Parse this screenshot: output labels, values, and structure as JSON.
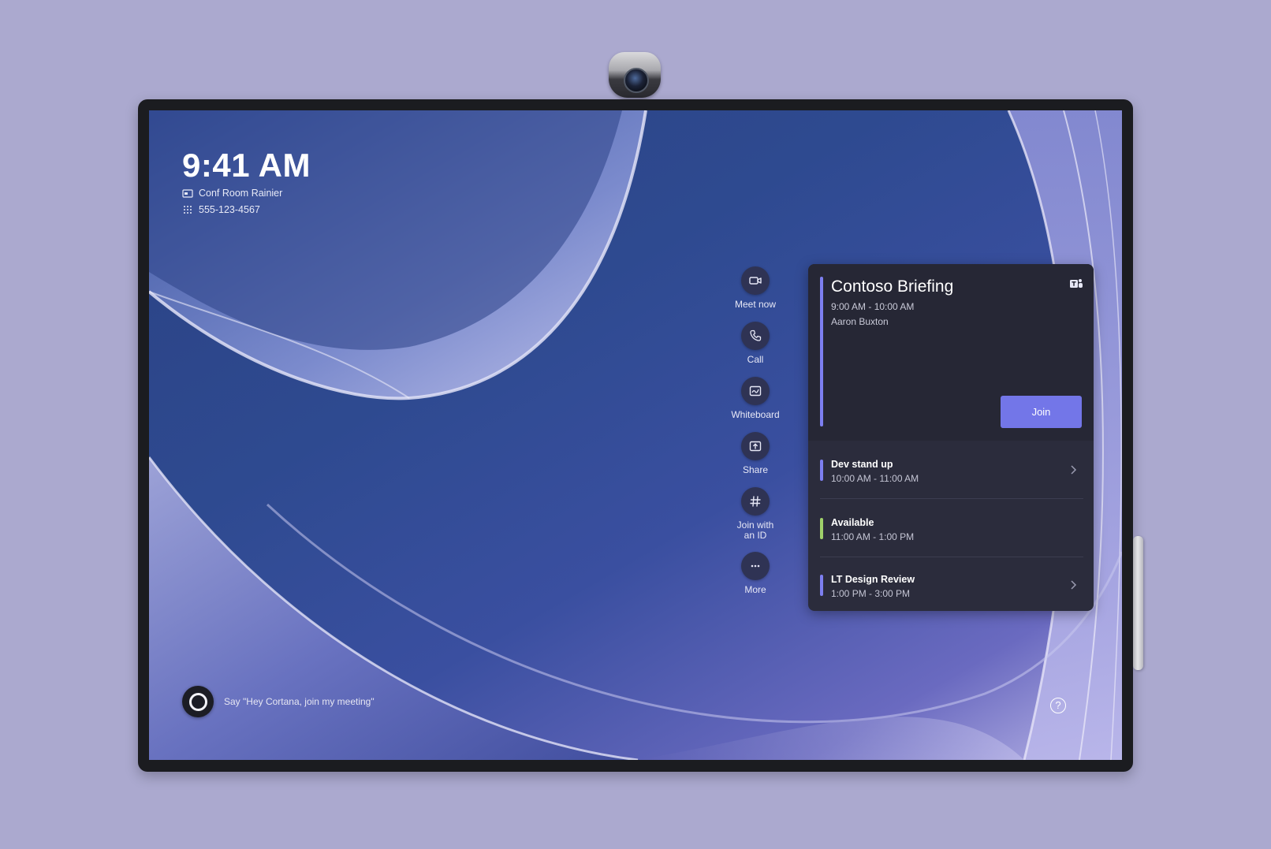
{
  "header": {
    "time": "9:41 AM",
    "room_name": "Conf Room Rainier",
    "phone": "555-123-4567"
  },
  "actions": [
    {
      "label": "Meet now",
      "icon": "video-camera-icon"
    },
    {
      "label": "Call",
      "icon": "phone-icon"
    },
    {
      "label": "Whiteboard",
      "icon": "whiteboard-icon"
    },
    {
      "label": "Share",
      "icon": "share-screen-icon"
    },
    {
      "label": "Join with an ID",
      "icon": "hash-icon"
    },
    {
      "label": "More",
      "icon": "more-icon"
    }
  ],
  "featured_meeting": {
    "title": "Contoso Briefing",
    "time": "9:00 AM - 10:00 AM",
    "organizer": "Aaron Buxton",
    "join_label": "Join"
  },
  "agenda": [
    {
      "name": "Dev stand up",
      "time": "10:00 AM - 11:00 AM",
      "color": "#7d7ff0",
      "has_chevron": true
    },
    {
      "name": "Available",
      "time": "11:00 AM - 1:00 PM",
      "color": "#9fd06a",
      "has_chevron": false
    },
    {
      "name": "LT Design Review",
      "time": "1:00 PM - 3:00 PM",
      "color": "#7d7ff0",
      "has_chevron": true
    }
  ],
  "footer": {
    "cortana_hint": "Say \"Hey Cortana, join my meeting\"",
    "help_symbol": "?"
  },
  "colors": {
    "background": "#aba9cf",
    "accent": "#7376e8",
    "panel": "#2b2c3c",
    "available": "#9fd06a"
  }
}
